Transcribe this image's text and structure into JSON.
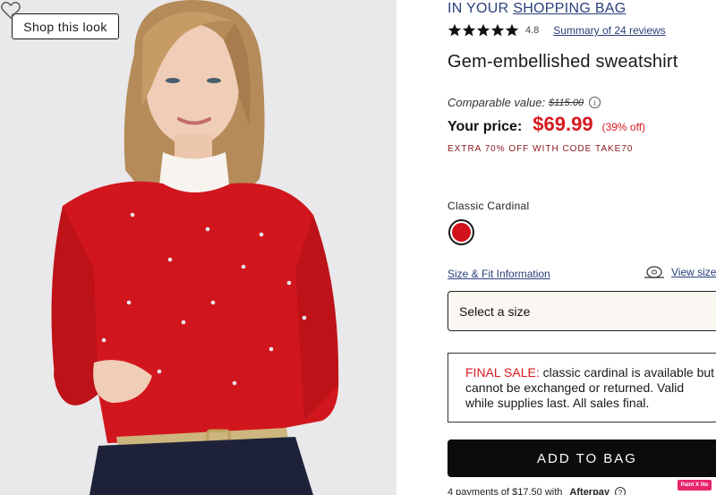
{
  "image": {
    "shop_look_label": "Shop this look",
    "favorite_icon": "heart-outline-icon"
  },
  "bag": {
    "prefix": "IN YOUR",
    "link": "SHOPPING BAG"
  },
  "rating": {
    "stars": 5,
    "value": "4.8",
    "reviews_link": "Summary of 24 reviews"
  },
  "product": {
    "title": "Gem-embellished sweatshirt"
  },
  "pricing": {
    "comparable_label": "Comparable value:",
    "comparable_value": "$115.00",
    "your_price_label": "Your price:",
    "your_price": "$69.99",
    "discount": "(39% off)",
    "promo": "EXTRA 70% OFF WITH CODE TAKE70"
  },
  "color": {
    "selected_name": "Classic Cardinal",
    "swatch_hex": "#d1131c"
  },
  "size": {
    "fit_link": "Size & Fit Information",
    "view_chart_link": "View size",
    "select_placeholder": "Select a size"
  },
  "final_sale": {
    "label": "FINAL SALE:",
    "text": " classic cardinal is available but cannot be exchanged or returned. Valid while supplies last. All sales final."
  },
  "cta": {
    "add_to_bag": "ADD TO BAG"
  },
  "afterpay": {
    "text": "4 payments of $17.50 with",
    "brand": "Afterpay"
  },
  "badge": {
    "paint_x": "Paint X lite"
  },
  "colors": {
    "sale_red": "#d7191f",
    "link_blue": "#2a3f7a",
    "promo_red": "#8b1a1f",
    "cta_black": "#0c0c0c"
  }
}
